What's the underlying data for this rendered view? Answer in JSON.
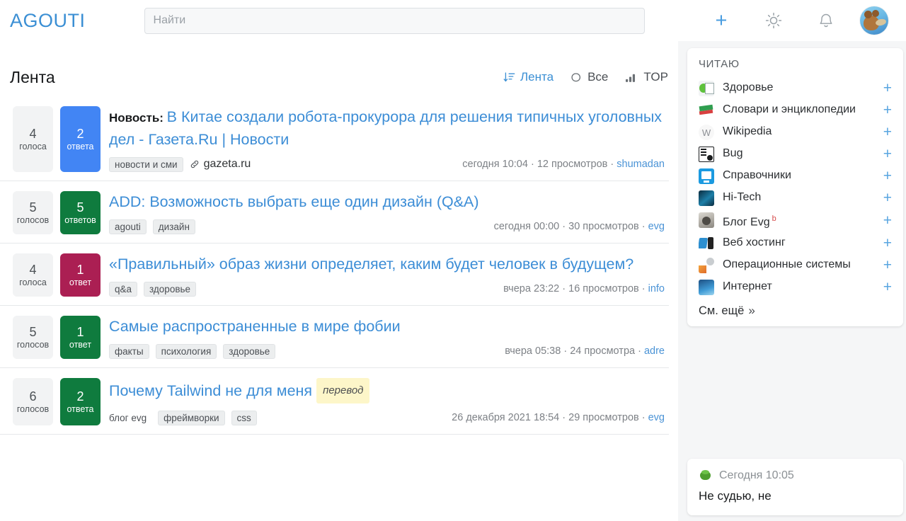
{
  "header": {
    "brand": "AGOUTI",
    "search_placeholder": "Найти",
    "search_value": "",
    "icons": [
      {
        "name": "add-icon",
        "glyph": "+"
      },
      {
        "name": "theme-sun-icon",
        "glyph": "sun"
      },
      {
        "name": "notifications-bell-icon",
        "glyph": "bell"
      },
      {
        "name": "user-avatar",
        "glyph": "avatar"
      }
    ]
  },
  "feed": {
    "title": "Лента",
    "tools": [
      {
        "label": "Лента",
        "icon": "sort-descending-icon",
        "active": true
      },
      {
        "label": "Все",
        "icon": "circle-outline-icon",
        "active": false
      },
      {
        "label": "TOP",
        "icon": "bar-chart-icon",
        "active": false
      }
    ],
    "posts": [
      {
        "votes_count": "4",
        "votes_label": "голоса",
        "answers_count": "2",
        "answers_label": "ответа",
        "answers_color": "#4285f4",
        "prefix": "Новость",
        "title": "В Китае создали робота-прокурора для решения типичных уголовных дел - Газета.Ru | Новости",
        "tags": [
          "новости и сми"
        ],
        "source": "gazeta.ru",
        "time": "сегодня 10:04",
        "views": "12 просмотров",
        "author": "shumadan",
        "translated": ""
      },
      {
        "votes_count": "5",
        "votes_label": "голосов",
        "answers_count": "5",
        "answers_label": "ответов",
        "answers_color": "#0f7b3e",
        "prefix": "",
        "title": "ADD: Возможность выбрать еще один дизайн (Q&A)",
        "tags": [
          "agouti",
          "дизайн"
        ],
        "source": "",
        "time": "сегодня 00:00",
        "views": "30 просмотров",
        "author": "evg",
        "translated": ""
      },
      {
        "votes_count": "4",
        "votes_label": "голоса",
        "answers_count": "1",
        "answers_label": "ответ",
        "answers_color": "#ab1f53",
        "prefix": "",
        "title": "«Правильный» образ жизни определяет, каким будет человек в будущем?",
        "tags": [
          "q&a",
          "здоровье"
        ],
        "source": "",
        "time": "вчера 23:22",
        "views": "16 просмотров",
        "author": "info",
        "translated": ""
      },
      {
        "votes_count": "5",
        "votes_label": "голосов",
        "answers_count": "1",
        "answers_label": "ответ",
        "answers_color": "#0f7b3e",
        "prefix": "",
        "title": "Самые распространенные в мире фобии",
        "tags": [
          "факты",
          "психология",
          "здоровье"
        ],
        "source": "",
        "time": "вчера 05:38",
        "views": "24 просмотра",
        "author": "adre",
        "translated": ""
      },
      {
        "votes_count": "6",
        "votes_label": "голосов",
        "answers_count": "2",
        "answers_label": "ответа",
        "answers_color": "#0f7b3e",
        "prefix": "",
        "title": "Почему Tailwind не для меня",
        "tags": [
          "блог evg",
          "фреймворки",
          "css"
        ],
        "plain_first_tag": true,
        "source": "",
        "time": "26 декабря 2021 18:54",
        "views": "29 просмотров",
        "author": "evg",
        "translated": "перевод"
      }
    ]
  },
  "sidebar": {
    "reading": {
      "heading": "ЧИТАЮ",
      "items": [
        {
          "label": "Здоровье",
          "icon": "apple-news-icon",
          "sup": ""
        },
        {
          "label": "Словари и энциклопедии",
          "icon": "books-icon",
          "sup": ""
        },
        {
          "label": "Wikipedia",
          "icon": "wikipedia-icon",
          "sup": ""
        },
        {
          "label": "Bug",
          "icon": "bug-report-icon",
          "sup": ""
        },
        {
          "label": "Справочники",
          "icon": "reference-icon",
          "sup": ""
        },
        {
          "label": "Hi-Tech",
          "icon": "hitech-icon",
          "sup": ""
        },
        {
          "label": "Блог Evg",
          "icon": "blog-icon",
          "sup": "b"
        },
        {
          "label": "Веб хостинг",
          "icon": "hosting-icon",
          "sup": ""
        },
        {
          "label": "Операционные системы",
          "icon": "os-icon",
          "sup": ""
        },
        {
          "label": "Интернет",
          "icon": "internet-icon",
          "sup": ""
        }
      ],
      "add_glyph": "+",
      "see_more": "См. ещё",
      "see_more_chevron": "»"
    },
    "comment": {
      "icon": "frog-avatar-icon",
      "time": "Сегодня 10:05",
      "text": "Не судью, не"
    }
  },
  "colors": {
    "brand": "#3b8fd4",
    "link": "#3c8dd6",
    "blue_badge": "#4285f4",
    "green_badge": "#0f7b3e",
    "crimson_badge": "#ab1f53",
    "translate_badge_bg": "#fdf6c9"
  }
}
